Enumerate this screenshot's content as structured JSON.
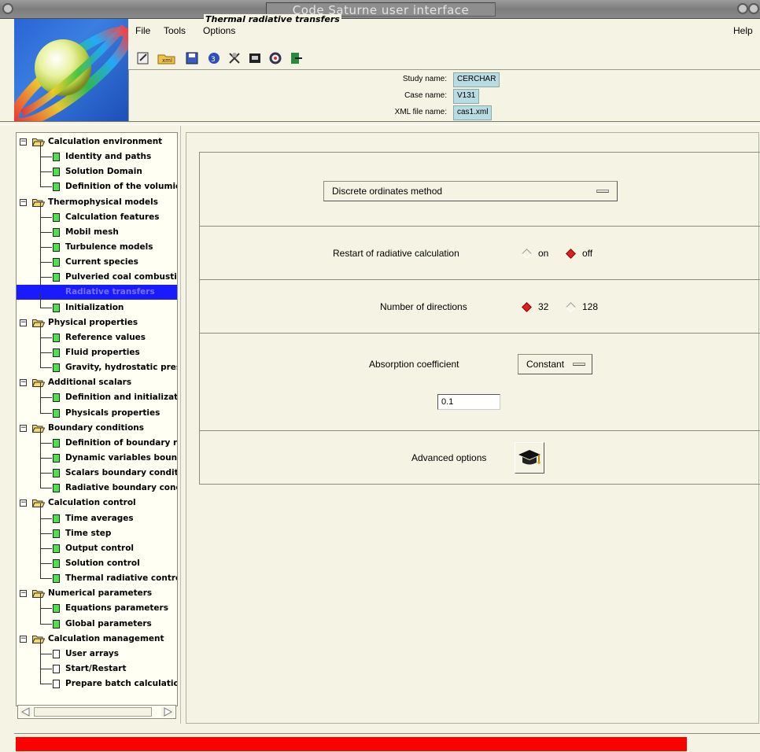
{
  "window": {
    "title": "Code Saturne user interface"
  },
  "menu": {
    "file": "File",
    "tools": "Tools",
    "options": "Options",
    "help": "Help"
  },
  "toolbar": {
    "icons": [
      "new-file-icon",
      "open-xml-icon",
      "save-icon",
      "refresh-icon",
      "tools-icon",
      "save-as-icon",
      "options-icon",
      "exit-icon"
    ]
  },
  "study_info": {
    "study_label": "Study name:",
    "study_value": "CERCHAR",
    "case_label": "Case name:",
    "case_value": "V131",
    "xml_label": "XML file name:",
    "xml_value": "cas1.xml"
  },
  "tree": {
    "items": [
      {
        "kind": "parent",
        "label": "Calculation environment"
      },
      {
        "kind": "child",
        "label": "Identity and paths"
      },
      {
        "kind": "child",
        "label": "Solution Domain"
      },
      {
        "kind": "child",
        "label": "Definition of the volumic"
      },
      {
        "kind": "parent",
        "label": "Thermophysical models"
      },
      {
        "kind": "child",
        "label": "Calculation features"
      },
      {
        "kind": "child",
        "label": "Mobil mesh"
      },
      {
        "kind": "child",
        "label": "Turbulence models"
      },
      {
        "kind": "child",
        "label": "Current species"
      },
      {
        "kind": "child",
        "label": "Pulveried coal combustio"
      },
      {
        "kind": "child",
        "label": "Radiative transfers",
        "selected": true
      },
      {
        "kind": "child",
        "label": "Initialization"
      },
      {
        "kind": "parent",
        "label": "Physical properties"
      },
      {
        "kind": "child",
        "label": "Reference values"
      },
      {
        "kind": "child",
        "label": "Fluid properties"
      },
      {
        "kind": "child",
        "label": "Gravity, hydrostatic pres"
      },
      {
        "kind": "parent",
        "label": "Additional scalars"
      },
      {
        "kind": "child",
        "label": "Definition and initializati"
      },
      {
        "kind": "child",
        "label": "Physicals properties"
      },
      {
        "kind": "parent",
        "label": "Boundary conditions"
      },
      {
        "kind": "child",
        "label": "Definition of boundary re"
      },
      {
        "kind": "child",
        "label": "Dynamic variables bound"
      },
      {
        "kind": "child",
        "label": "Scalars boundary conditi"
      },
      {
        "kind": "child",
        "label": "Radiative boundary condi"
      },
      {
        "kind": "parent",
        "label": "Calculation control"
      },
      {
        "kind": "child",
        "label": "Time averages"
      },
      {
        "kind": "child",
        "label": "Time step"
      },
      {
        "kind": "child",
        "label": "Output control"
      },
      {
        "kind": "child",
        "label": "Solution control"
      },
      {
        "kind": "child",
        "label": "Thermal radiative control"
      },
      {
        "kind": "parent",
        "label": "Numerical parameters"
      },
      {
        "kind": "child",
        "label": "Equations parameters"
      },
      {
        "kind": "child",
        "label": "Global parameters"
      },
      {
        "kind": "parent",
        "label": "Calculation management"
      },
      {
        "kind": "child",
        "label": "User arrays",
        "white": true
      },
      {
        "kind": "child",
        "label": "Start/Restart",
        "white": true
      },
      {
        "kind": "child",
        "label": "Prepare batch calculation",
        "white": true
      }
    ]
  },
  "panel": {
    "group_title": "Thermal radiative transfers",
    "method_value": "Discrete ordinates method",
    "restart_label": "Restart of radiative calculation",
    "restart_on": "on",
    "restart_off": "off",
    "restart_selected": "off",
    "directions_label": "Number of directions",
    "directions_32": "32",
    "directions_128": "128",
    "directions_selected": "32",
    "absorption_label": "Absorption coefficient",
    "absorption_mode": "Constant",
    "absorption_value": "0.1",
    "advanced_label": "Advanced options"
  },
  "status": {
    "progress_fraction": 0.9,
    "progress_color": "#ff0000"
  }
}
